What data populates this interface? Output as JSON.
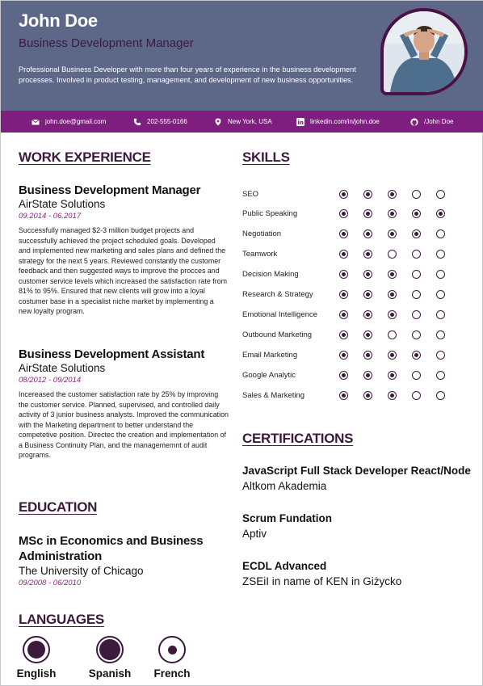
{
  "header": {
    "name": "John Doe",
    "title": "Business Development Manager",
    "summary": "Professional Business Developer with more than four years of experience in the business development processes. Involved in product testing, management, and development of new business opportunities.",
    "photo_icon": "person-photo"
  },
  "contact": {
    "email": "john.doe@gmail.com",
    "phone": "202-555-0166",
    "location": "New York, USA",
    "linkedin": "linkedin.com/in/john.doe",
    "github": "/John Doe"
  },
  "sections": {
    "work": "WORK EXPERIENCE",
    "education": "EDUCATION",
    "languages": "LANGUAGES",
    "skills": "SKILLS",
    "certifications": "CERTIFICATIONS"
  },
  "work": [
    {
      "title": "Business Development Manager",
      "company": "AirState Solutions",
      "dates": "09.2014 - 06.2017",
      "description": "Successfully managed $2-3 million budget projects and successfully achieved the project scheduled goals. Developed and implemented new marketing and sales plans and defined the strategy for the next 5 years. Reviewed constantly the customer feedback and then suggested ways to improve the procces and customer service levels which increased the satisfaction rate from 81% to 95%. Ensured that new clients will grow into a loyal costumer base in a specialist niche market by implementing a new loyalty program."
    },
    {
      "title": "Business Development Assistant",
      "company": "AirState Solutions",
      "dates": "08/2012 - 09/2014",
      "description": "Incereased the customer satisfaction rate by 25% by improving the customer service. Planned, supervised, and controlled daily activity of 3 junior business analysts. Improved the communication with the Marketing department to better understand the competetive position. Directec the creation and implementation of a Business Continuity Plan, and the managememnt of audit programs."
    }
  ],
  "education": {
    "degree": "MSc in Economics and Business Administration",
    "school": "The University of Chicago",
    "dates": "09/2008 - 06/2010"
  },
  "languages": [
    {
      "name": "English",
      "level": 0.8
    },
    {
      "name": "Spanish",
      "level": 1.0
    },
    {
      "name": "French",
      "level": 0.3
    }
  ],
  "skills": [
    {
      "name": "SEO",
      "rating": 3
    },
    {
      "name": "Public Speaking",
      "rating": 5
    },
    {
      "name": "Negotiation",
      "rating": 4
    },
    {
      "name": "Teamwork",
      "rating": 2
    },
    {
      "name": "Decision Making",
      "rating": 3
    },
    {
      "name": "Research & Strategy",
      "rating": 3
    },
    {
      "name": "Emotional Intelligence",
      "rating": 3
    },
    {
      "name": "Outbound Marketing",
      "rating": 2
    },
    {
      "name": "Email Marketing",
      "rating": 4
    },
    {
      "name": "Google Analytic",
      "rating": 3
    },
    {
      "name": "Sales & Marketing",
      "rating": 3
    }
  ],
  "skills_max": 5,
  "certifications": [
    {
      "name": "JavaScript Full Stack Developer React/Node",
      "issuer": "Altkom Akademia"
    },
    {
      "name": "Scrum Fundation",
      "issuer": "Aptiv"
    },
    {
      "name": "ECDL Advanced",
      "issuer": "ZSEiI in name of KEN in Giżycko"
    }
  ],
  "colors": {
    "header_bg": "#5d6888",
    "accent": "#7e1f7f",
    "dark": "#3b1a3e",
    "date": "#8a2a7f"
  }
}
